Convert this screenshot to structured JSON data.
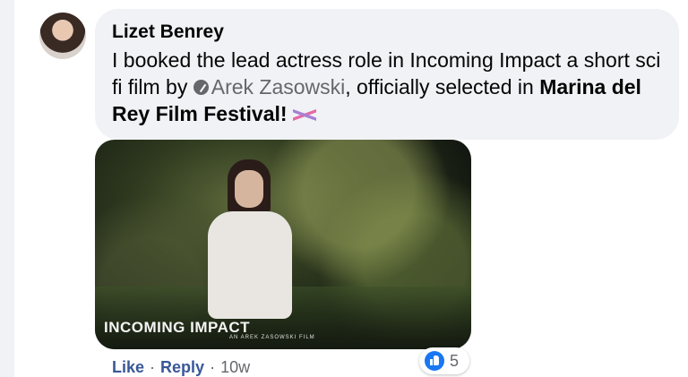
{
  "comment": {
    "author": "Lizet Benrey",
    "text_before_mention": "I booked the lead actress role in Incoming Impact a short sci fi film by ",
    "mention": "Arek Zasowski",
    "text_after_mention": ", officially selected in ",
    "page_tag": "Marina del Rey Film Festival!",
    "icons": {
      "mention": "verified-check-icon",
      "emoji": "sparkle-icon"
    }
  },
  "media": {
    "title": "INCOMING IMPACT",
    "subtitle": "AN AREK ZASOWSKI FILM"
  },
  "reactions": {
    "icon": "like-icon",
    "count": "5",
    "accent": "#1877f2"
  },
  "actions": {
    "like_label": "Like",
    "separator": "·",
    "reply_label": "Reply",
    "time": "10w"
  }
}
